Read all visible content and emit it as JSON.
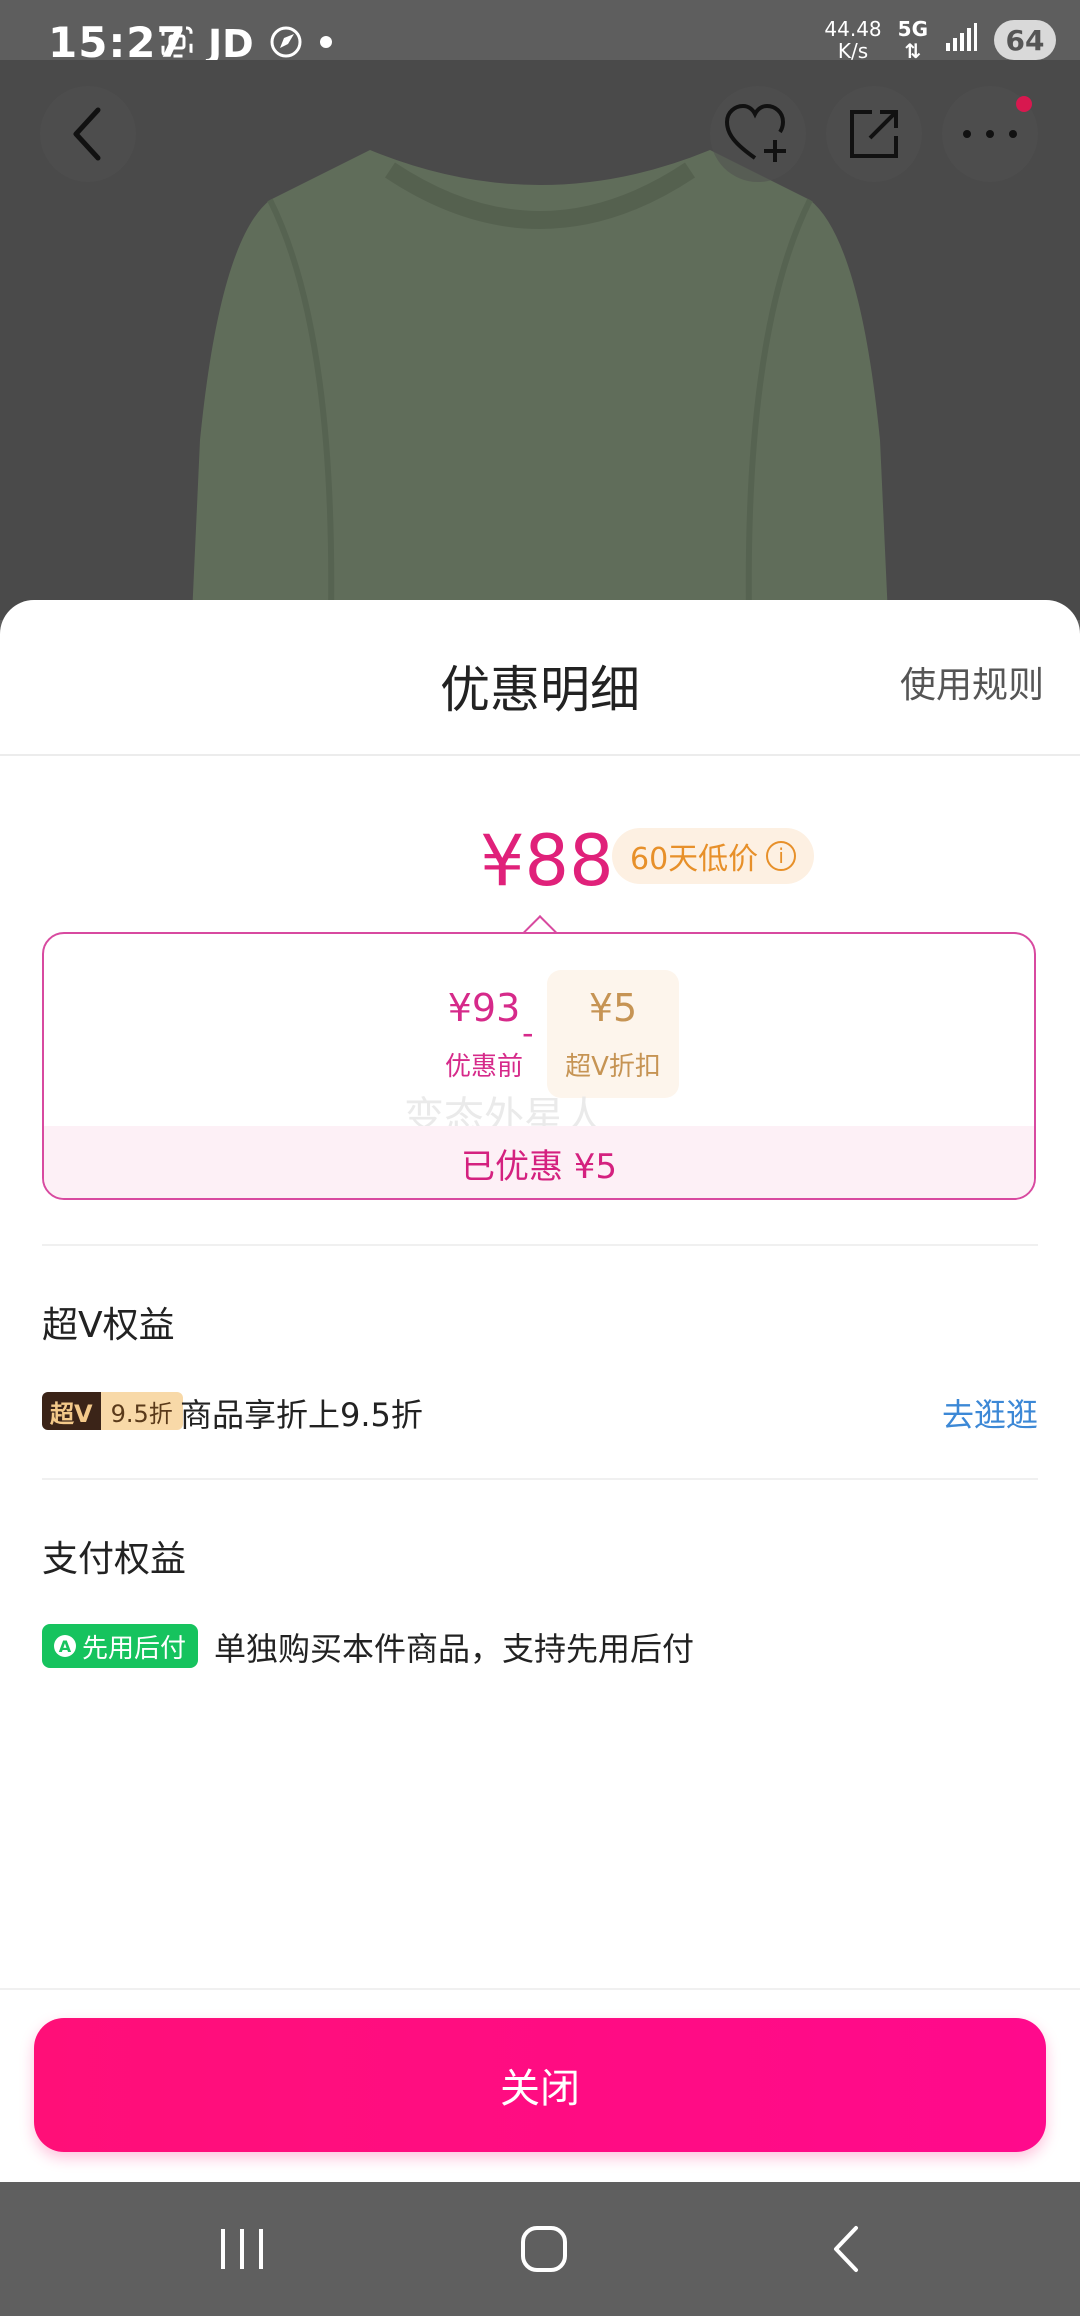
{
  "status_bar": {
    "time": "15:27",
    "carrier_icon_text": "JD",
    "net_speed_value": "44.48",
    "net_speed_unit": "K/s",
    "network": "5G",
    "battery": "64",
    "icons": [
      "screenshot-icon",
      "jd-icon",
      "compass-icon",
      "dot-icon",
      "arrows-icon",
      "signal-icon",
      "battery-icon"
    ]
  },
  "header": {
    "back_icon": "chevron-left-icon",
    "favorite_icon": "heart-plus-icon",
    "share_icon": "share-icon",
    "more_icon": "more-dots-icon",
    "notification_color": "#d8184f"
  },
  "sheet": {
    "title": "优惠明细",
    "rules_link": "使用规则",
    "final_price": "¥88",
    "low_price_badge": "60天低价",
    "original_price": "¥93",
    "original_label": "优惠前",
    "minus": "-",
    "discount_amount": "¥5",
    "discount_label": "超V折扣",
    "watermark": "变态外星人",
    "saved_text": "已优惠 ¥5",
    "super_v": {
      "section_title": "超V权益",
      "badge_left": "超V",
      "badge_right": "9.5折",
      "description": "商品享折上9.5折",
      "link": "去逛逛"
    },
    "payment": {
      "section_title": "支付权益",
      "badge": "先用后付",
      "description": "单独购买本件商品，支持先用后付"
    },
    "close_button": "关闭"
  },
  "colors": {
    "accent": "#ff0f78",
    "price": "#e0217a",
    "link": "#3c88d6",
    "payment_green": "#16c35e"
  },
  "nav_bar": {
    "icons": [
      "recents-icon",
      "home-icon",
      "back-icon"
    ]
  }
}
